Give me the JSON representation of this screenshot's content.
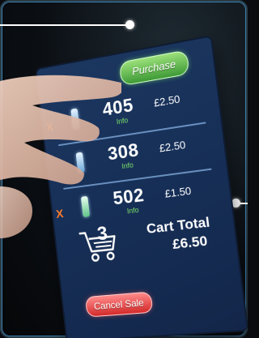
{
  "pos": {
    "purchase_label": "Purchase",
    "cancel_label": "Cancel Sale",
    "items": [
      {
        "qty": "405",
        "info": "Info",
        "price": "£2.50",
        "removable": true
      },
      {
        "qty": "308",
        "info": "Info",
        "price": "£2.50",
        "removable": false
      },
      {
        "qty": "502",
        "info": "Info",
        "price": "£1.50",
        "removable": true
      }
    ],
    "remove_mark": "X",
    "cart_count": "3",
    "cart_total_label": "Cart Total",
    "cart_total_value": "£6.50"
  },
  "icons": [
    "remove-icon",
    "bottle-icon",
    "cart-icon"
  ],
  "colors": {
    "screen": "#173058",
    "purchase": "#3e9a36",
    "cancel": "#d42a2a",
    "info": "#7fe36a",
    "remove": "#ff7a2a"
  }
}
